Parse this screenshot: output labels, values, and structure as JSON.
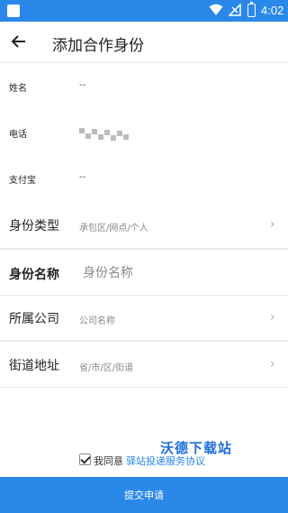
{
  "status_bar": {
    "time": "4:02",
    "bg_color": "#2a88e8"
  },
  "header": {
    "title": "添加合作身份"
  },
  "info": [
    {
      "label": "姓名",
      "value": "--"
    },
    {
      "label": "电话",
      "value": ""
    },
    {
      "label": "支付宝",
      "value": "--"
    }
  ],
  "form": {
    "identity_type": {
      "label": "身份类型",
      "placeholder": "承包区/网点/个人"
    },
    "identity_name": {
      "label": "身份名称",
      "placeholder": "身份名称"
    },
    "company": {
      "label": "所属公司",
      "placeholder": "公司名称"
    },
    "address": {
      "label": "街道地址",
      "placeholder": "省/市/区/街道"
    }
  },
  "agreement": {
    "prefix": "我同意",
    "link": "驿站投递服务协议",
    "checked": true
  },
  "watermark": "沃德下载站",
  "submit_label": "提交申请",
  "accent_color": "#2a88e8"
}
